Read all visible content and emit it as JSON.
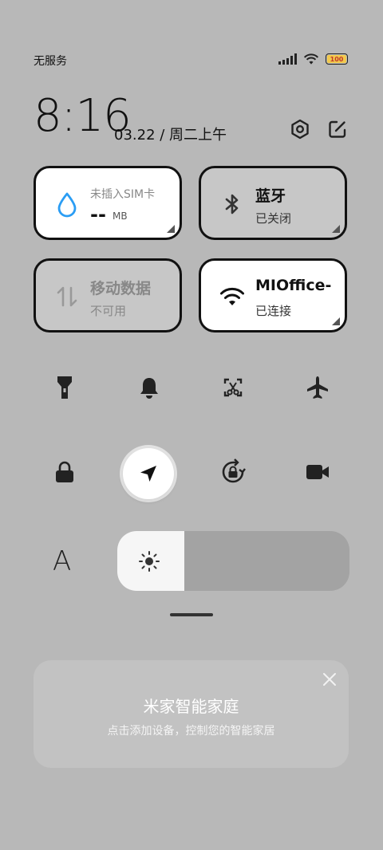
{
  "status_bar": {
    "carrier": "无服务",
    "battery_level": "100"
  },
  "header": {
    "time": "8:16",
    "date": "03.22 / 周二上午",
    "settings_icon": "gear-icon",
    "edit_icon": "edit-icon"
  },
  "tiles": {
    "data_usage": {
      "title": "未插入SIM卡",
      "value": "--",
      "unit": "MB",
      "icon": "water-drop-icon"
    },
    "bluetooth": {
      "title": "蓝牙",
      "status": "已关闭",
      "icon": "bluetooth-icon"
    },
    "mobile_data": {
      "title": "移动数据",
      "status": "不可用",
      "icon": "mobile-data-icon"
    },
    "wifi": {
      "title": "MIOffice-",
      "status": "已连接",
      "icon": "wifi-icon"
    }
  },
  "toggles": {
    "row1": [
      "flashlight-icon",
      "bell-icon",
      "screenshot-icon",
      "airplane-icon"
    ],
    "row2": [
      "lock-icon",
      "location-icon",
      "rotation-lock-icon",
      "video-icon"
    ]
  },
  "brightness": {
    "level": 0.29,
    "font_size_label": "A"
  },
  "mi_home": {
    "title": "米家智能家庭",
    "subtitle": "点击添加设备，控制您的智能家居"
  },
  "colors": {
    "background": "#b8b8b8",
    "tile_active": "#ffffff",
    "accent_blue": "#2a9df4"
  }
}
